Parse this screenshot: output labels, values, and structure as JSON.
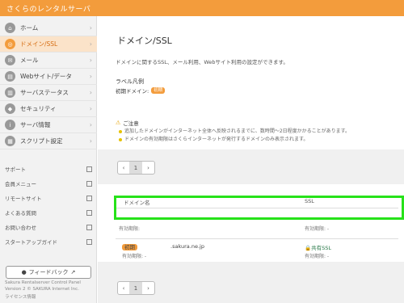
{
  "app": {
    "title": "さくらのレンタルサーバ"
  },
  "sidebar": {
    "items": [
      {
        "label": "ホーム",
        "icon": "home-icon"
      },
      {
        "label": "ドメイン/SSL",
        "icon": "globe-icon"
      },
      {
        "label": "メール",
        "icon": "mail-icon"
      },
      {
        "label": "Webサイト/データ",
        "icon": "folder-icon"
      },
      {
        "label": "サーバステータス",
        "icon": "server-icon"
      },
      {
        "label": "セキュリティ",
        "icon": "lock-icon"
      },
      {
        "label": "サーバ情報",
        "icon": "info-icon"
      },
      {
        "label": "スクリプト設定",
        "icon": "script-icon"
      }
    ],
    "links": [
      "サポート",
      "会員メニュー",
      "リモートサイト",
      "よくある質問",
      "お問い合わせ",
      "スタートアップガイド"
    ],
    "feedback": "フィードバック",
    "footer_line1": "Sakura Rentalserver Control Panel",
    "footer_line2": "Version 2 © SAKURA Internet Inc.",
    "footer_line3": "ライセンス情報"
  },
  "main": {
    "title": "ドメイン/SSL",
    "description": "ドメインに関するSSL、メール利用、Webサイト利用の設定ができます。",
    "legend_title": "ラベル凡例",
    "legend_label": "初期ドメイン:",
    "legend_badge": "初期",
    "notice_title": "ご注意",
    "notice_lines": [
      "追加したドメインがインターネット全体へ反映されるまでに、数時間〜2日程度かかることがあります。",
      "ドメインの有効期限はさくらインターネットが発行するドメインのみ表示されます。"
    ],
    "pager": {
      "prev": "‹",
      "page": "1",
      "next": "›"
    },
    "table": {
      "col_domain": "ドメイン名",
      "col_ssl": "SSL",
      "rows": [
        {
          "badge": "",
          "domain": "",
          "expiry": "有効期限: ",
          "ssl": "-",
          "ssl_expiry": "有効期限: -"
        },
        {
          "badge": "初期",
          "domain": ".sakura.ne.jp",
          "expiry": "有効期限: -",
          "ssl": "共有SSL",
          "ssl_expiry": "有効期限: -"
        }
      ]
    }
  },
  "colors": {
    "accent": "#f39c3c",
    "highlight": "#27e21a"
  }
}
